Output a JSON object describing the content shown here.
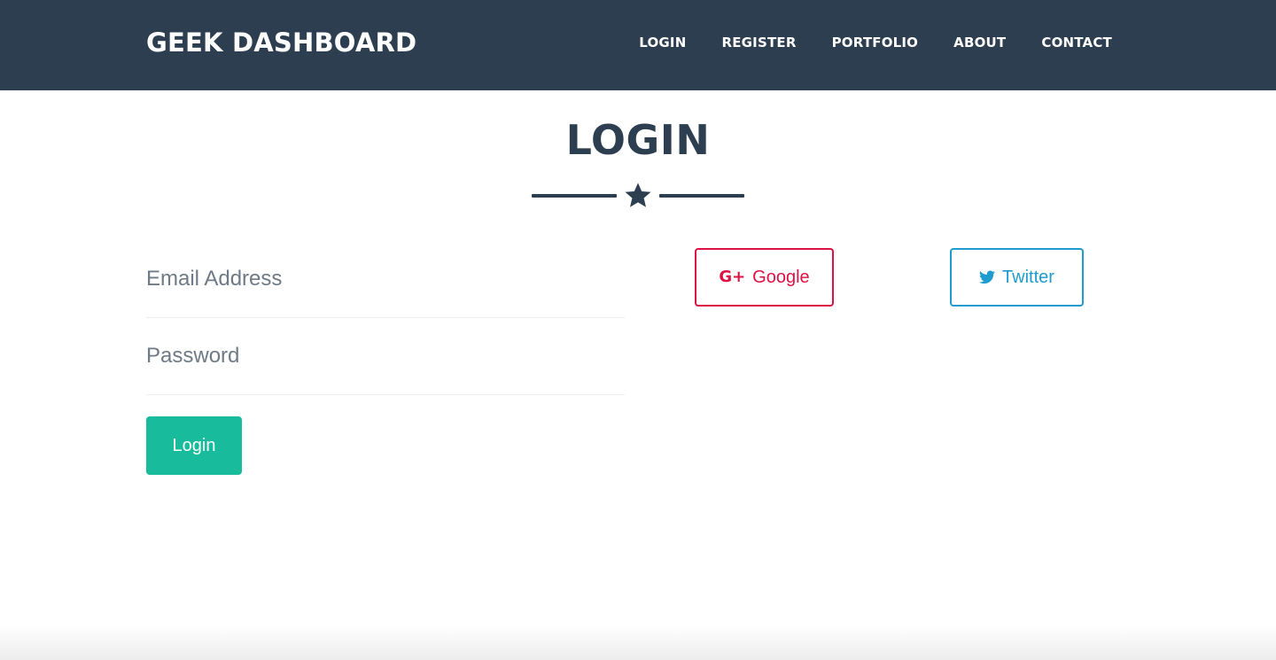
{
  "navbar": {
    "brand": "GEEK DASHBOARD",
    "links": [
      "LOGIN",
      "REGISTER",
      "PORTFOLIO",
      "ABOUT",
      "CONTACT"
    ],
    "background_color": "#2c3e50"
  },
  "main": {
    "title": "LOGIN",
    "divider_icon": "star-icon",
    "form": {
      "email_placeholder": "Email Address",
      "password_placeholder": "Password",
      "submit_label": "Login",
      "submit_color": "#18bc9c"
    },
    "social": {
      "google": {
        "label": "Google",
        "icon": "google-plus-icon",
        "color": "#dd1144"
      },
      "twitter": {
        "label": "Twitter",
        "icon": "twitter-bird-icon",
        "color": "#1f9bcf"
      }
    }
  }
}
